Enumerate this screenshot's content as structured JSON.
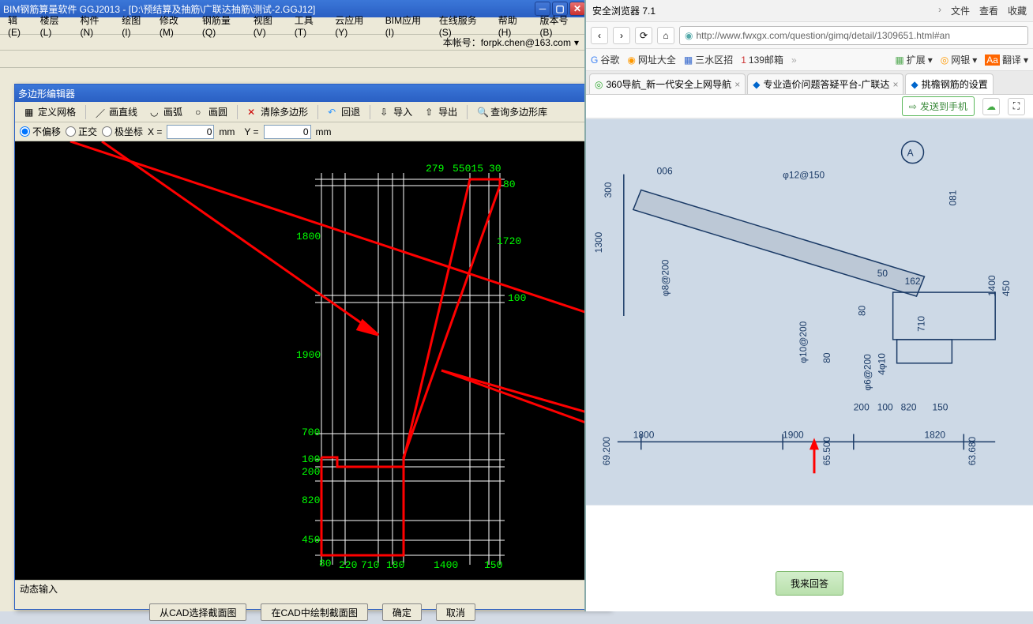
{
  "app": {
    "title": "BIM钢筋算量软件 GGJ2013 - [D:\\预结算及抽筋\\广联达抽筋\\测试-2.GGJ12]",
    "email_label": "本帐号：",
    "email": "forpk.chen@163.com",
    "menus": [
      "楼层(L)",
      "构件(N)",
      "绘图(I)",
      "修改(M)",
      "钢筋量(Q)",
      "视图(V)",
      "工具(T)",
      "云应用(Y)",
      "BIM应用(I)",
      "在线服务(S)",
      "帮助(H)",
      "版本号(B)"
    ],
    "first_menu_frag": "辑(E)"
  },
  "dialog": {
    "title": "多边形编辑器",
    "tools": {
      "define_grid": "定义网格",
      "draw_line": "画直线",
      "draw_arc": "画弧",
      "draw_circle": "画圆",
      "clear_poly": "清除多边形",
      "undo": "回退",
      "import": "导入",
      "export": "导出",
      "query_lib": "查询多边形库"
    },
    "subbar": {
      "no_offset": "不偏移",
      "ortho": "正交",
      "polar": "极坐标",
      "x_label": "X =",
      "x_val": "0",
      "x_unit": "mm",
      "y_label": "Y =",
      "y_val": "0",
      "y_unit": "mm"
    },
    "dyn_input": "动态输入",
    "buttons": {
      "select_cad": "从CAD选择截面图",
      "draw_cad": "在CAD中绘制截面图",
      "ok": "确定",
      "cancel": "取消"
    },
    "dims": {
      "top1": "279",
      "top2": "55015",
      "top3": "30",
      "right1": "80",
      "right2": "1720",
      "right3": "100",
      "left1": "1800",
      "left2": "1900",
      "left3": "700",
      "left4": "100",
      "left5": "200",
      "left6": "820",
      "left7": "450",
      "bot1": "80",
      "bot2": "220",
      "bot3": "710",
      "bot4": "180",
      "bot5": "1400",
      "bot6": "150"
    }
  },
  "browser": {
    "name": "安全浏览器 7.1",
    "menu": {
      "file": "文件",
      "view": "查看",
      "fav": "收藏"
    },
    "url": "http://www.fwxgx.com/question/gimq/detail/1309651.html#an",
    "bookmarks": {
      "google": "谷歌",
      "sites": "网址大全",
      "sanshui": "三水区招",
      "mail139": "139邮箱",
      "ext": "扩展",
      "bank": "网银",
      "translate": "翻译"
    },
    "tabs": {
      "t1": "360导航_新一代安全上网导航",
      "t2": "专业造价问题答疑平台-广联达",
      "t3": "挑檐钢筋的设置"
    },
    "send_phone": "发送到手机",
    "blueprint_values": {
      "v1800": "1800",
      "v1900": "1900",
      "v1820": "1820",
      "v69200": "69.200",
      "v65500": "65.500",
      "v63680": "63.680",
      "v1300": "1300",
      "v300": "300",
      "v006": "006",
      "v12150": "φ12@150",
      "v81": "081",
      "v8200": "φ8@200",
      "v10200": "φ10@200",
      "v1400": "1400",
      "v450": "450",
      "v710": "710",
      "v200": "200",
      "v100": "100",
      "v80_a": "80",
      "v80_b": "80",
      "v4f10": "4φ10",
      "v6200": "φ6@200",
      "v820": "820",
      "v150": "150",
      "v162": "162",
      "v50": "50"
    },
    "answer_btn": "我来回答",
    "circle_a": "A"
  }
}
